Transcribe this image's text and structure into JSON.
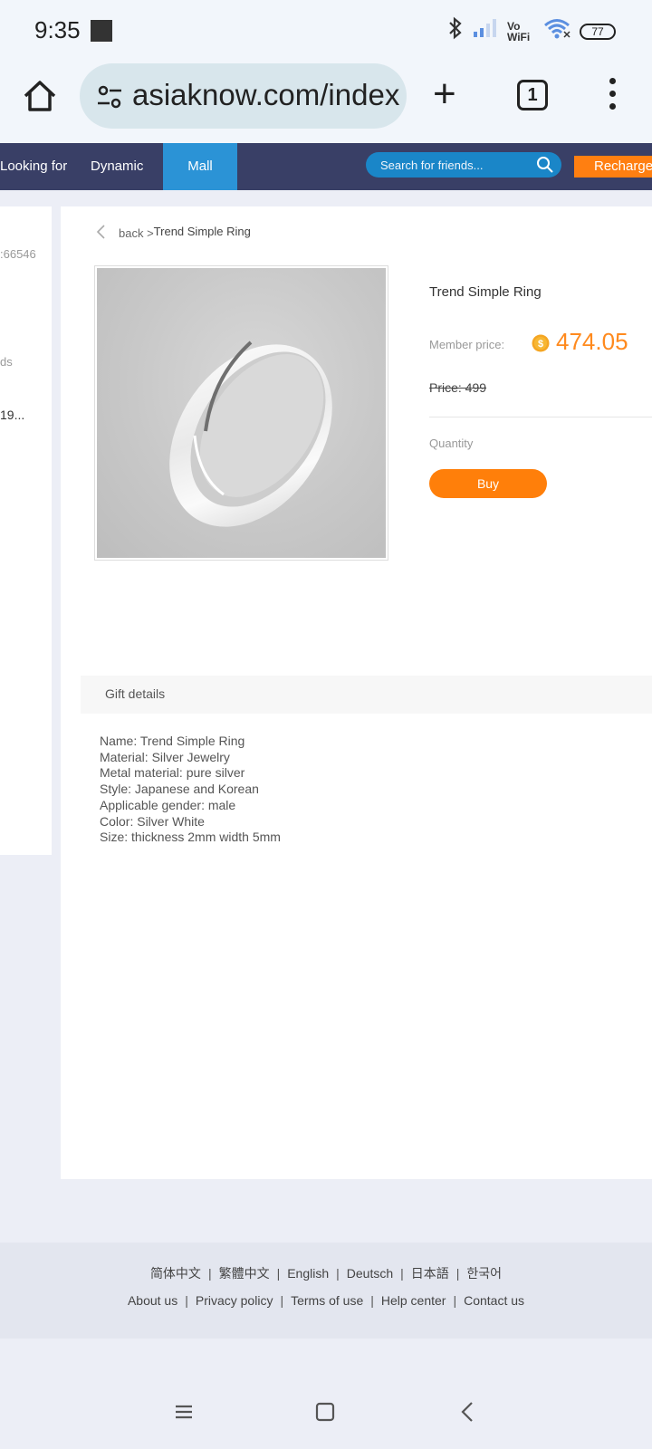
{
  "status_bar": {
    "time": "9:35",
    "vowifi_top": "Vo",
    "vowifi_bottom": "WiFi",
    "battery": "77",
    "battery_level": 0.77
  },
  "browser": {
    "url": "asiaknow.com/index",
    "tab_count": "1"
  },
  "nav": {
    "looking_for": "Looking for",
    "dynamic": "Dynamic",
    "mall": "Mall",
    "search_placeholder": "Search for friends...",
    "recharge": "Recharge",
    "active_color": "#2b93d6",
    "bar_color": "#393f66"
  },
  "left_panel": {
    "id_text": ":66546",
    "ds_text": "ds",
    "num_text": "19..."
  },
  "breadcrumb": {
    "back": "back >",
    "current": "Trend Simple Ring"
  },
  "product": {
    "name": "Trend Simple Ring",
    "member_price_label": "Member price:",
    "member_price": "474.05",
    "price_label": "Price: 499",
    "quantity_label": "Quantity",
    "buy_label": "Buy",
    "accent_color": "#ff7f0a"
  },
  "gift": {
    "header": "Gift details",
    "lines": [
      "Name: Trend Simple Ring",
      "Material: Silver Jewelry",
      "Metal material: pure silver",
      "Style: Japanese and Korean",
      "Applicable gender: male",
      "Color: Silver White",
      "Size: thickness 2mm width 5mm"
    ]
  },
  "footer": {
    "languages": [
      "简体中文",
      "繁體中文",
      "English",
      "Deutsch",
      "日本語",
      "한국어"
    ],
    "links": [
      "About us",
      "Privacy policy",
      "Terms of use",
      "Help center",
      "Contact us"
    ]
  }
}
